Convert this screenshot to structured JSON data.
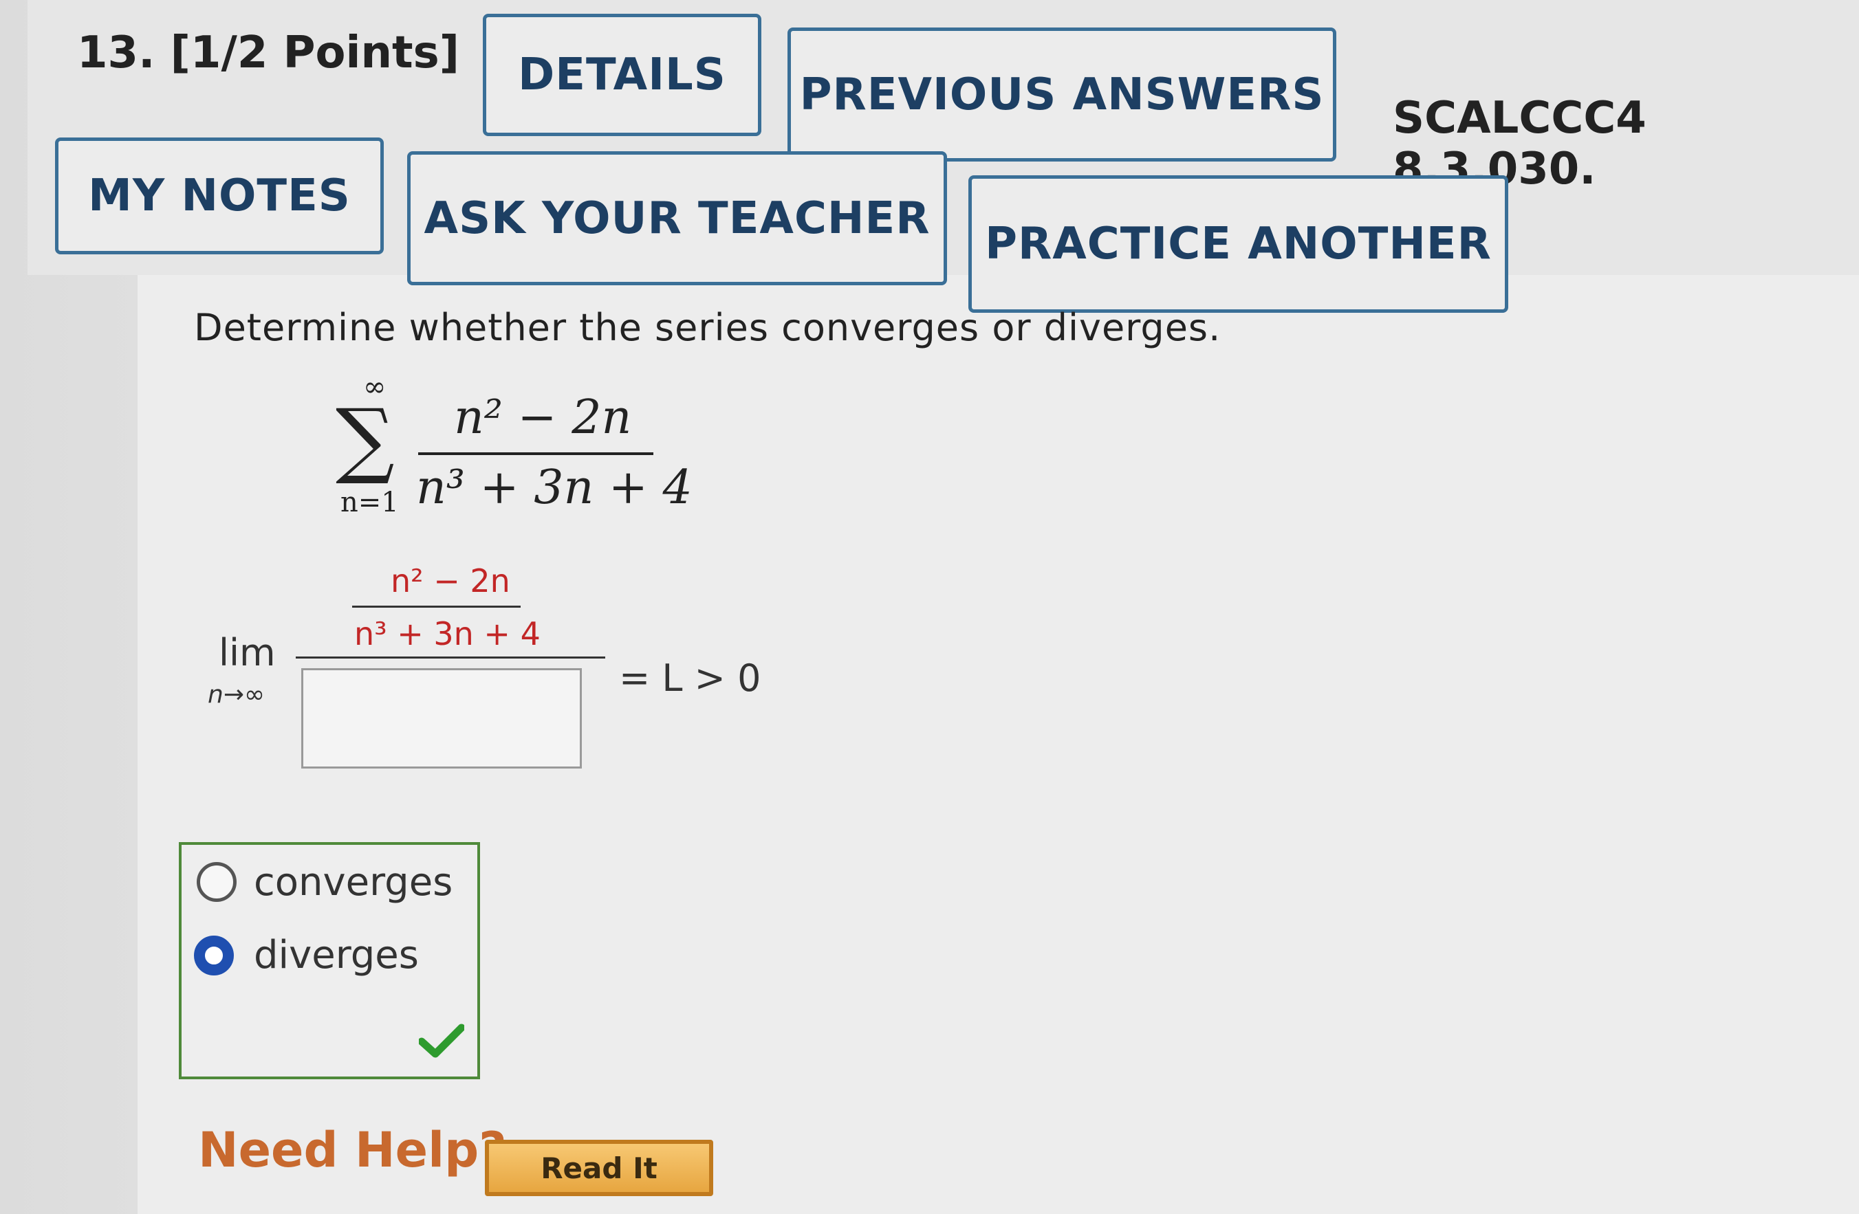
{
  "question": {
    "number": "13.",
    "points": "[1/2 Points]",
    "id": "SCALCCC4 8.3.030."
  },
  "buttons": {
    "details": "DETAILS",
    "previous_answers": "PREVIOUS ANSWERS",
    "my_notes": "MY NOTES",
    "ask_teacher": "ASK YOUR TEACHER",
    "practice_another": "PRACTICE ANOTHER"
  },
  "prompt": "Determine whether the series converges or diverges.",
  "series": {
    "sigma": "∑",
    "upper": "∞",
    "lower": "n=1",
    "numerator": "n² − 2n",
    "denominator": "n³ + 3n + 4"
  },
  "limit": {
    "word": "lim",
    "sub": "n→∞",
    "inner_numerator": "n² − 2n",
    "inner_denominator": "n³ + 3n + 4",
    "answer_value": "",
    "rhs": "= L > 0"
  },
  "choices": {
    "options": [
      {
        "label": "converges",
        "selected": false
      },
      {
        "label": "diverges",
        "selected": true
      }
    ],
    "feedback_icon": "check-icon",
    "colors": {
      "correct_border": "#4f8a3a",
      "selected_radio": "#1f4fb0",
      "check": "#2e9b2e"
    }
  },
  "help": {
    "need_help": "Need Help?",
    "read_it": "Read It"
  },
  "colors": {
    "button_border": "#3a6f97",
    "button_text": "#1d3f63",
    "need_help": "#c8692e",
    "read_it_bg": "#f0b955",
    "accent_red": "#c22626"
  }
}
